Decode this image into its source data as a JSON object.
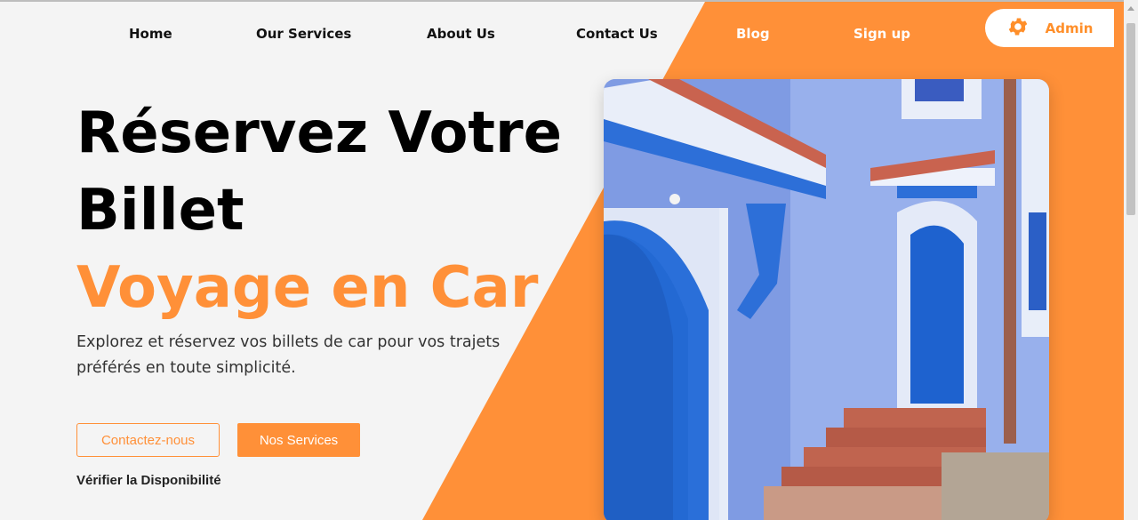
{
  "nav": {
    "home": "Home",
    "services": "Our Services",
    "about": "About Us",
    "contact": "Contact Us",
    "blog": "Blog",
    "signup": "Sign up",
    "admin": "Admin"
  },
  "hero": {
    "title_line1": "Réservez Votre",
    "title_line2": "Billet",
    "title_highlight": "Voyage en Car",
    "description": "Explorez et réservez vos billets de car pour vos trajets préférés en toute simplicité.",
    "btn_contact": "Contactez-nous",
    "btn_services": "Nos Services",
    "check_availability": "Vérifier la Disponibilité"
  },
  "colors": {
    "accent": "#ff9038",
    "text": "#111111",
    "background": "#f4f4f4"
  },
  "icons": {
    "admin": "gear-icon"
  }
}
